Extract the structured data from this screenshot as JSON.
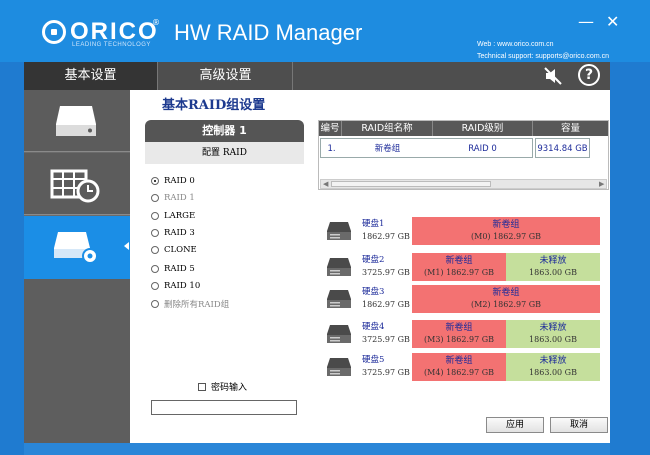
{
  "header": {
    "brand": "ORICO",
    "brand_sub": "LEADING TECHNOLOGY",
    "registered": "®",
    "app_title": "HW RAID Manager",
    "web": "Web : www.orico.com.cn",
    "support": "Technical support: supports@orico.com.cn",
    "minimize": "—",
    "close": "✕"
  },
  "tabs": [
    {
      "label": "基本设置"
    },
    {
      "label": "高级设置"
    }
  ],
  "toolbar": {
    "help": "?"
  },
  "main": {
    "title": "基本RAID组设置",
    "controller": "控制器 1",
    "config_label": "配置 RAID",
    "raid_options": [
      {
        "label": "RAID 0",
        "selected": true,
        "enabled": true
      },
      {
        "label": "RAID 1",
        "selected": false,
        "enabled": false
      },
      {
        "label": "LARGE",
        "selected": false,
        "enabled": true
      },
      {
        "label": "RAID 3",
        "selected": false,
        "enabled": true
      },
      {
        "label": "CLONE",
        "selected": false,
        "enabled": true
      },
      {
        "label": "RAID 5",
        "selected": false,
        "enabled": true
      },
      {
        "label": "RAID 10",
        "selected": false,
        "enabled": true
      },
      {
        "label": "删除所有RAID组",
        "selected": false,
        "enabled": false
      }
    ],
    "password_label": "密码输入",
    "table": {
      "headers": [
        "编号",
        "RAID组名称",
        "RAID级别",
        "容量"
      ],
      "rows": [
        {
          "no": "1.",
          "name": "新卷组",
          "level": "RAID 0",
          "capacity": "9314.84 GB"
        }
      ]
    },
    "disks": [
      {
        "name": "硬盘1",
        "size": "1862.97 GB",
        "segments": [
          {
            "top": "新卷组",
            "bottom": "(M0) 1862.97 GB",
            "color": "red"
          }
        ]
      },
      {
        "name": "硬盘2",
        "size": "3725.97 GB",
        "segments": [
          {
            "top": "新卷组",
            "bottom": "(M1) 1862.97 GB",
            "color": "red"
          },
          {
            "top": "未释放",
            "bottom": "1863.00 GB",
            "color": "green"
          }
        ]
      },
      {
        "name": "硬盘3",
        "size": "1862.97 GB",
        "segments": [
          {
            "top": "新卷组",
            "bottom": "(M2) 1862.97 GB",
            "color": "red"
          }
        ]
      },
      {
        "name": "硬盘4",
        "size": "3725.97 GB",
        "segments": [
          {
            "top": "新卷组",
            "bottom": "(M3) 1862.97 GB",
            "color": "red"
          },
          {
            "top": "未释放",
            "bottom": "1863.00 GB",
            "color": "green"
          }
        ]
      },
      {
        "name": "硬盘5",
        "size": "3725.97 GB",
        "segments": [
          {
            "top": "新卷组",
            "bottom": "(M4) 1862.97 GB",
            "color": "red"
          },
          {
            "top": "未释放",
            "bottom": "1863.00 GB",
            "color": "green"
          }
        ]
      }
    ],
    "apply_label": "应用",
    "cancel_label": "取消"
  },
  "colors": {
    "header_blue": "#1e8ce0",
    "tab_dark": "#343434",
    "sidebar_active": "#1b8ee6",
    "segment_red": "#f37272",
    "segment_green": "#c5df9c",
    "text_navy": "#1d2b9a"
  },
  "sidebar": [
    {
      "icon": "hard-drive-icon"
    },
    {
      "icon": "disk-grid-clock-icon"
    },
    {
      "icon": "disk-settings-icon",
      "active": true
    }
  ]
}
